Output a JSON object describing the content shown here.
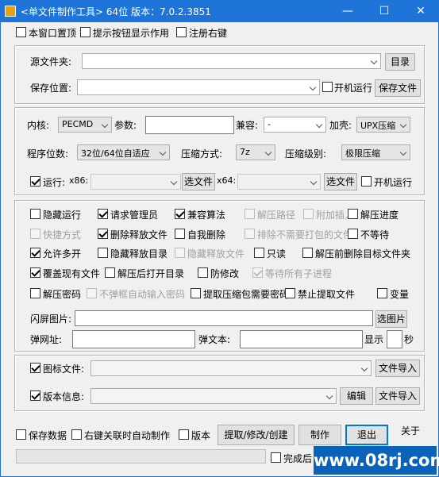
{
  "window": {
    "title": "<单文件制作工具> 64位 版本：7.0.2.3851",
    "minimize": "—",
    "maximize": "☐",
    "close": "✕"
  },
  "top_options": [
    {
      "label": "本窗口置顶",
      "checked": false
    },
    {
      "label": "提示按钮显示作用",
      "checked": false
    },
    {
      "label": "注册右键",
      "checked": false
    }
  ],
  "source": {
    "label": "源文件夹:",
    "value": "",
    "browse": "目录"
  },
  "save": {
    "label": "保存位置:",
    "value": "",
    "autorun_label": "开机运行",
    "autorun": false,
    "save_btn": "保存文件"
  },
  "core": {
    "label": "内核:",
    "value": "PECMD",
    "param_label": "参数:",
    "param_value": "",
    "compat_label": "兼容:",
    "compat_value": "-",
    "shell_label": "加壳:",
    "shell_value": "UPX压缩"
  },
  "bits": {
    "label": "程序位数:",
    "value": "32位/64位自适应",
    "method_label": "压缩方式:",
    "method_value": "7z",
    "level_label": "压缩级别:",
    "level_value": "极限压缩"
  },
  "run": {
    "label": "运行:",
    "checked": true,
    "x86_label": "x86:",
    "x86_value": "",
    "x86_btn": "选文件",
    "x64_label": "x64:",
    "x64_value": "",
    "x64_btn": "选文件",
    "boot_label": "开机运行",
    "boot": false
  },
  "options": [
    {
      "label": "隐藏运行",
      "checked": false,
      "disabled": false
    },
    {
      "label": "请求管理员",
      "checked": true,
      "disabled": false
    },
    {
      "label": "兼容算法",
      "checked": true,
      "disabled": false
    },
    {
      "label": "解压路径",
      "checked": false,
      "disabled": true
    },
    {
      "label": "附加插入",
      "checked": false,
      "disabled": true
    },
    {
      "label": "解压进度",
      "checked": false,
      "disabled": false
    },
    {
      "label": "快捷方式",
      "checked": false,
      "disabled": true
    },
    {
      "label": "删除释放文件",
      "checked": true,
      "disabled": false
    },
    {
      "label": "自我删除",
      "checked": false,
      "disabled": false
    },
    {
      "label": "排除不需要打包的文件",
      "checked": false,
      "disabled": true
    },
    {
      "label": "不等待",
      "checked": false,
      "disabled": false
    },
    {
      "label": "允许多开",
      "checked": true,
      "disabled": false
    },
    {
      "label": "隐藏释放目录",
      "checked": false,
      "disabled": false
    },
    {
      "label": "隐藏释放文件",
      "checked": false,
      "disabled": true
    },
    {
      "label": "只读",
      "checked": false,
      "disabled": false
    },
    {
      "label": "解压前删除目标文件夹",
      "checked": false,
      "disabled": false
    },
    {
      "label": "覆盖现有文件",
      "checked": true,
      "disabled": false
    },
    {
      "label": "解压后打开目录",
      "checked": false,
      "disabled": false
    },
    {
      "label": "防修改",
      "checked": false,
      "disabled": false
    },
    {
      "label": "等待所有子进程",
      "checked": true,
      "disabled": true
    },
    {
      "label": "解压密码",
      "checked": false,
      "disabled": false
    },
    {
      "label": "不弹框自动输入密码",
      "checked": false,
      "disabled": true
    },
    {
      "label": "提取压缩包需要密码",
      "checked": false,
      "disabled": false
    },
    {
      "label": "禁止提取文件",
      "checked": false,
      "disabled": false
    },
    {
      "label": "变量",
      "checked": false,
      "disabled": false
    }
  ],
  "splash": {
    "label": "闪屏图片:",
    "value": "",
    "btn": "选图片"
  },
  "popup": {
    "url_label": "弹网址:",
    "url_value": "",
    "text_label": "弹文本:",
    "text_value": "",
    "show_label": "显示",
    "seconds_value": "",
    "sec_label": "秒"
  },
  "icon": {
    "label": "图标文件:",
    "checked": true,
    "value": "",
    "btn": "文件导入"
  },
  "version": {
    "label": "版本信息:",
    "checked": true,
    "value": "",
    "edit_btn": "编辑",
    "import_btn": "文件导入"
  },
  "bottom": {
    "save_data": {
      "label": "保存数据",
      "checked": false
    },
    "rightclick": {
      "label": "右键关联时自动制作",
      "checked": false
    },
    "ver": {
      "label": "版本",
      "checked": false
    },
    "extract_btn": "提取/修改/创建",
    "make_btn": "制作",
    "exit_btn": "退出",
    "about": "关于",
    "progress": 0,
    "done_label": "完成后",
    "done_checked": false
  },
  "watermark": "www.08rj.com",
  "colors": {
    "titlebar": "#1e74d9",
    "watermark_bg": "#0a63b8"
  }
}
